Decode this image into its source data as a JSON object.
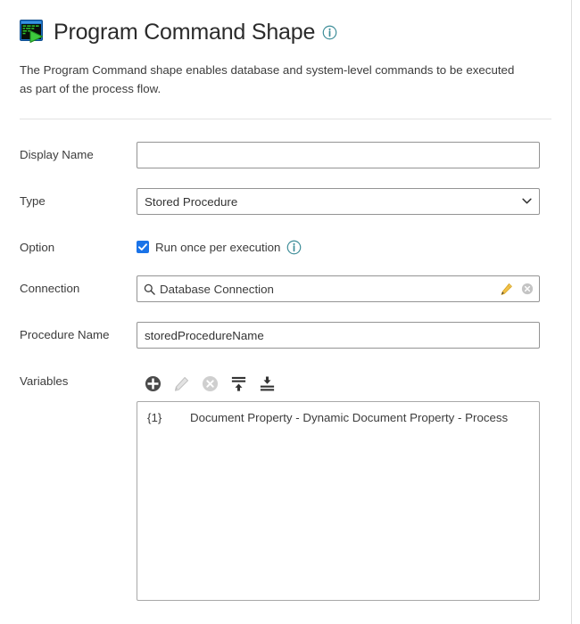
{
  "header": {
    "icon": "program-command-shape-icon",
    "title": "Program Command Shape",
    "info_icon": "info-icon",
    "description": "The Program Command shape enables database and system-level commands to be executed as part of the process flow."
  },
  "form": {
    "display_name": {
      "label": "Display Name",
      "value": "",
      "placeholder": ""
    },
    "type": {
      "label": "Type",
      "value": "Stored Procedure",
      "options": [
        "Stored Procedure"
      ],
      "chevron_icon": "chevron-down-icon"
    },
    "option": {
      "label": "Option",
      "checkbox_label": "Run once per execution",
      "checked": true,
      "info_icon": "info-icon"
    },
    "connection": {
      "label": "Connection",
      "value": "Database Connection",
      "search_icon": "search-icon",
      "edit_icon": "pencil-icon",
      "clear_icon": "clear-circle-icon"
    },
    "procedure_name": {
      "label": "Procedure Name",
      "value": "storedProcedureName",
      "placeholder": ""
    },
    "variables": {
      "label": "Variables",
      "toolbar": [
        {
          "name": "add-variable-button",
          "icon": "plus-circle-icon",
          "enabled": true
        },
        {
          "name": "edit-variable-button",
          "icon": "pencil-icon",
          "enabled": false
        },
        {
          "name": "delete-variable-button",
          "icon": "delete-circle-icon",
          "enabled": false
        },
        {
          "name": "move-up-button",
          "icon": "move-to-top-icon",
          "enabled": true
        },
        {
          "name": "move-down-button",
          "icon": "move-to-bottom-icon",
          "enabled": true
        }
      ],
      "items": [
        {
          "key": "{1}",
          "text": "Document Property - Dynamic Document Property - Process"
        }
      ]
    }
  },
  "colors": {
    "accent_blue": "#1a73e8",
    "info_teal": "#2e8b96",
    "border": "#949494",
    "text": "#3c3c3c",
    "icon_dark": "#4d4d4d",
    "icon_disabled": "#c8c8c8"
  }
}
